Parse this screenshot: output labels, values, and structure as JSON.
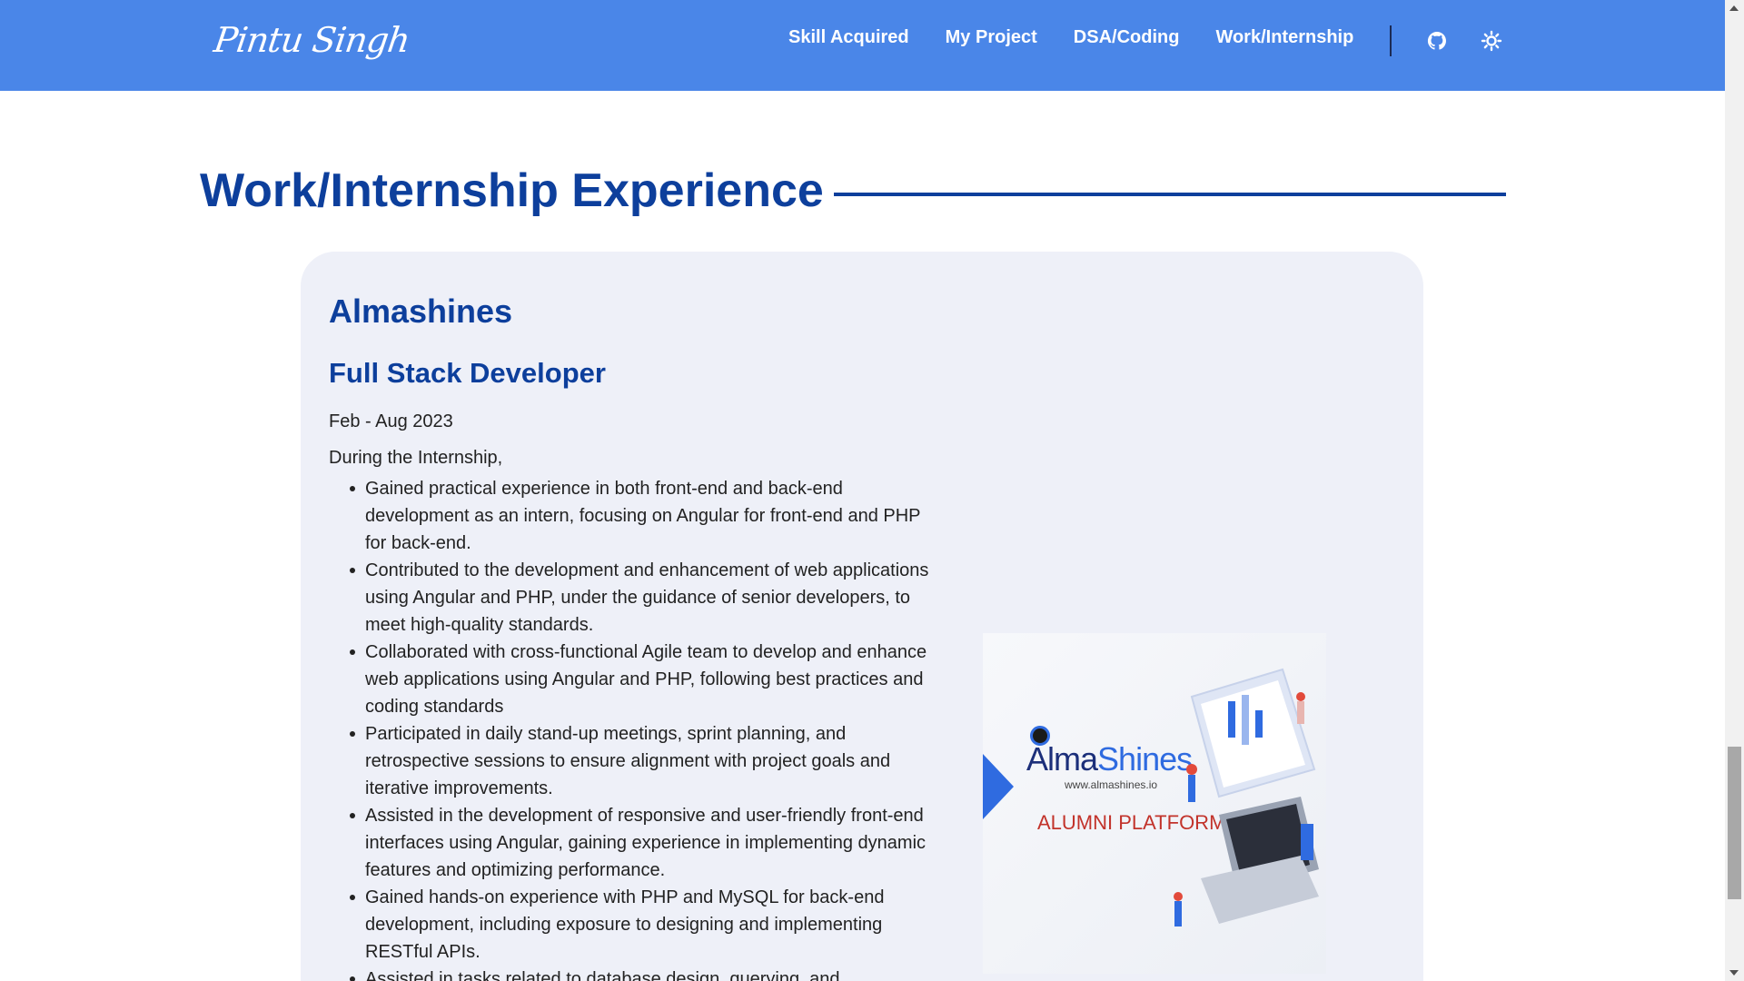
{
  "header": {
    "logo": "Pintu Singh",
    "nav": [
      "Skill Acquired",
      "My Project",
      "DSA/Coding",
      "Work/Internship"
    ],
    "icons": [
      "github-icon",
      "theme-toggle-icon"
    ]
  },
  "section": {
    "title": "Work/Internship Experience"
  },
  "experience": {
    "company": "Almashines",
    "role": "Full Stack Developer",
    "dates": "Feb - Aug 2023",
    "intro": "During the Internship,",
    "bullets": [
      "Gained practical experience in both front-end and back-end development as an intern, focusing on Angular for front-end and PHP for back-end.",
      "Contributed to the development and enhancement of web applications using Angular and PHP, under the guidance of senior developers, to meet high-quality standards.",
      "Collaborated with cross-functional Agile team to develop and enhance web applications using Angular and PHP, following best practices and coding standards",
      "Participated in daily stand-up meetings, sprint planning, and retrospective sessions to ensure alignment with project goals and iterative improvements.",
      "Assisted in the development of responsive and user-friendly front-end interfaces using Angular, gaining experience in implementing dynamic features and optimizing performance.",
      "Gained hands-on experience with PHP and MySQL for back-end development, including exposure to designing and implementing RESTful APIs.",
      "Assisted in tasks related to database design, querying, and"
    ],
    "image": {
      "brand_part1": "Alma",
      "brand_part2": "Shines",
      "url": "www.almashines.io",
      "tagline": "ALUMNI PLATFORM"
    }
  },
  "colors": {
    "navbar": "#4a86e8",
    "heading": "#0d3f9c",
    "card": "#eef0f8"
  }
}
